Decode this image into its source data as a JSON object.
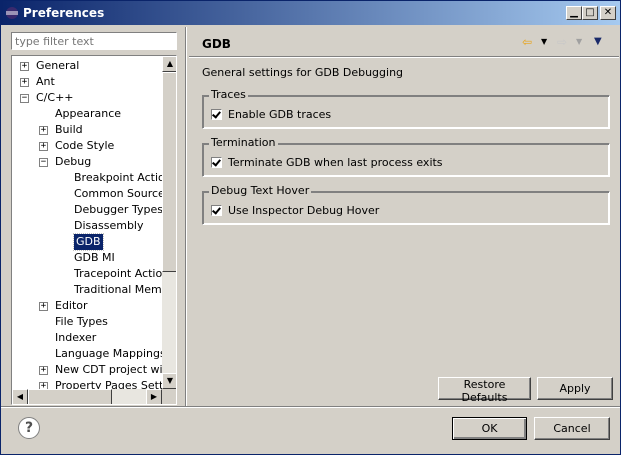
{
  "window": {
    "title": "Preferences"
  },
  "filter": {
    "placeholder": "type filter text"
  },
  "tree": {
    "items": [
      {
        "label": "General",
        "expander": "+"
      },
      {
        "label": "Ant",
        "expander": "+"
      },
      {
        "label": "C/C++",
        "expander": "−"
      },
      {
        "label": "Appearance",
        "expander": ""
      },
      {
        "label": "Build",
        "expander": "+"
      },
      {
        "label": "Code Style",
        "expander": "+"
      },
      {
        "label": "Debug",
        "expander": "−"
      },
      {
        "label": "Breakpoint Actions",
        "expander": ""
      },
      {
        "label": "Common Source Lo",
        "expander": ""
      },
      {
        "label": "Debugger Types",
        "expander": ""
      },
      {
        "label": "Disassembly",
        "expander": ""
      },
      {
        "label": "GDB",
        "expander": "",
        "selected": true
      },
      {
        "label": "GDB MI",
        "expander": ""
      },
      {
        "label": "Tracepoint Actions",
        "expander": ""
      },
      {
        "label": "Traditional Memory",
        "expander": ""
      },
      {
        "label": "Editor",
        "expander": "+"
      },
      {
        "label": "File Types",
        "expander": ""
      },
      {
        "label": "Indexer",
        "expander": ""
      },
      {
        "label": "Language Mappings",
        "expander": ""
      },
      {
        "label": "New CDT project wizar",
        "expander": "+"
      },
      {
        "label": "Property Pages Setting",
        "expander": "+"
      }
    ]
  },
  "page": {
    "title": "GDB",
    "description": "General settings for GDB Debugging",
    "groups": [
      {
        "label": "Traces",
        "checkbox_label": "Enable GDB traces",
        "checked": true
      },
      {
        "label": "Termination",
        "checkbox_label": "Terminate GDB when last process exits",
        "checked": true
      },
      {
        "label": "Debug Text Hover",
        "checkbox_label": "Use Inspector Debug  Hover",
        "checked": true
      }
    ],
    "restore_defaults_label": "Restore Defaults",
    "apply_label": "Apply"
  },
  "dialog": {
    "ok_label": "OK",
    "cancel_label": "Cancel",
    "help_glyph": "?"
  },
  "colors": {
    "selection": "#0a246a",
    "titlebar_start": "#0a246a",
    "titlebar_end": "#a6caf0",
    "nav_back": "#e8a317"
  }
}
